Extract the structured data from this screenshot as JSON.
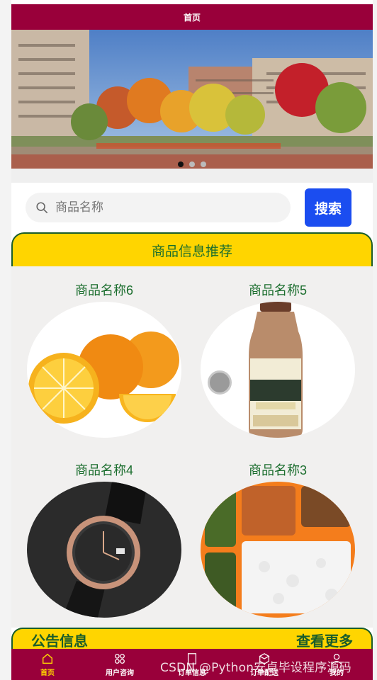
{
  "nav": {
    "title": "首页"
  },
  "carousel": {
    "slides": 3,
    "active": 1
  },
  "search": {
    "placeholder": "商品名称",
    "button": "搜索"
  },
  "recommend": {
    "title": "商品信息推荐",
    "items": [
      {
        "name": "商品名称6",
        "image": "oranges"
      },
      {
        "name": "商品名称5",
        "image": "milk-coffee-bottle"
      },
      {
        "name": "商品名称4",
        "image": "wristwatch"
      },
      {
        "name": "商品名称3",
        "image": "rice-meal-tray"
      }
    ]
  },
  "notice": {
    "title": "公告信息",
    "more": "查看更多"
  },
  "tabbar": {
    "items": [
      {
        "label": "首页",
        "icon": "home-icon",
        "active": true
      },
      {
        "label": "用户咨询",
        "icon": "grid-icon",
        "active": false
      },
      {
        "label": "订单信息",
        "icon": "document-icon",
        "active": false
      },
      {
        "label": "订单配送",
        "icon": "shield-icon",
        "active": false
      },
      {
        "label": "我的",
        "icon": "user-icon",
        "active": false
      }
    ]
  },
  "watermark": "CSDN @Python安卓毕设程序源码",
  "colors": {
    "brand": "#99003a",
    "accent": "#ffd500",
    "green": "#1a6d2d",
    "button": "#1b4df0"
  }
}
